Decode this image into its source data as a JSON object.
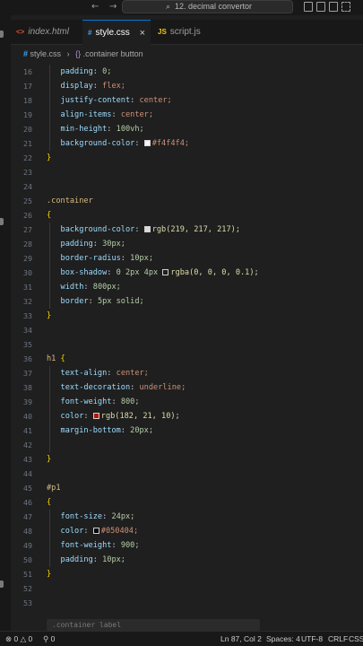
{
  "titlebar": {
    "back_icon": "arrow-left-icon",
    "forward_icon": "arrow-right-icon",
    "search_text": "12. decimal convertor"
  },
  "tabs": [
    {
      "label": "index.html",
      "icon": "html-icon",
      "icon_glyph": "<>",
      "color": "#e44d26",
      "active": false
    },
    {
      "label": "style.css",
      "icon": "css-icon",
      "icon_glyph": "#",
      "color": "#42a5f5",
      "active": true,
      "close": "×"
    },
    {
      "label": "script.js",
      "icon": "js-icon",
      "icon_glyph": "JS",
      "color": "#f1c40f",
      "active": false
    }
  ],
  "breadcrumb": {
    "file": "style.css",
    "selector": ".container button",
    "separator": "›"
  },
  "editor": {
    "colors": {
      "line_number": "#6e7681",
      "selector": "#d7ba7d",
      "property": "#9cdcfe",
      "value": "#ce9178",
      "number": "#b5cea8",
      "brace": "#ffd700",
      "function": "#dcdcaa",
      "plain": "#cccccc"
    },
    "lines": [
      {
        "n": "16",
        "indent": 1,
        "prop": "padding",
        "val": "0;"
      },
      {
        "n": "17",
        "indent": 1,
        "prop": "display",
        "val": "flex;"
      },
      {
        "n": "18",
        "indent": 1,
        "prop": "justify-content",
        "val": "center;"
      },
      {
        "n": "19",
        "indent": 1,
        "prop": "align-items",
        "val": "center;"
      },
      {
        "n": "20",
        "indent": 1,
        "prop": "min-height",
        "val": "100vh;"
      },
      {
        "n": "21",
        "indent": 1,
        "prop": "background-color",
        "val": "#f4f4f4;",
        "swatch": "#f4f4f4"
      },
      {
        "n": "22",
        "brace": "}"
      },
      {
        "n": "23"
      },
      {
        "n": "24"
      },
      {
        "n": "25",
        "selector": ".container"
      },
      {
        "n": "26",
        "brace": "{"
      },
      {
        "n": "27",
        "indent": 1,
        "prop": "background-color",
        "val": "rgb(219, 217, 217);",
        "swatch": "#dbd9d9"
      },
      {
        "n": "28",
        "indent": 1,
        "prop": "padding",
        "val": "30px;"
      },
      {
        "n": "29",
        "indent": 1,
        "prop": "border-radius",
        "val": "10px;"
      },
      {
        "n": "30",
        "indent": 1,
        "prop": "box-shadow",
        "pre": "0 2px 4px ",
        "val": "rgba(0, 0, 0, 0.1);",
        "swatch": "#1f1f1f"
      },
      {
        "n": "31",
        "indent": 1,
        "prop": "width",
        "val": "800px;"
      },
      {
        "n": "32",
        "indent": 1,
        "prop": "border",
        "val": "5px solid;"
      },
      {
        "n": "33",
        "brace": "}"
      },
      {
        "n": "34"
      },
      {
        "n": "35"
      },
      {
        "n": "36",
        "selector": "h1 ",
        "brace_inline": "{"
      },
      {
        "n": "37",
        "indent": 1,
        "prop": "text-align",
        "val": "center;"
      },
      {
        "n": "38",
        "indent": 1,
        "prop": "text-decoration",
        "val": "underline;"
      },
      {
        "n": "39",
        "indent": 1,
        "prop": "font-weight",
        "val": "800;"
      },
      {
        "n": "40",
        "indent": 1,
        "prop": "color",
        "val": "rgb(182, 21, 10);",
        "swatch": "#b6150a"
      },
      {
        "n": "41",
        "indent": 1,
        "prop": "margin-bottom",
        "val": "20px;"
      },
      {
        "n": "42"
      },
      {
        "n": "43",
        "brace": "}"
      },
      {
        "n": "44"
      },
      {
        "n": "45",
        "selector": "#p1"
      },
      {
        "n": "46",
        "brace": "{"
      },
      {
        "n": "47",
        "indent": 1,
        "prop": "font-size",
        "val": "24px;"
      },
      {
        "n": "48",
        "indent": 1,
        "prop": "color",
        "val": "#050404;",
        "swatch": "#050404"
      },
      {
        "n": "49",
        "indent": 1,
        "prop": "font-weight",
        "val": "900;"
      },
      {
        "n": "50",
        "indent": 1,
        "prop": "padding",
        "val": "10px;"
      },
      {
        "n": "51",
        "brace": "}"
      },
      {
        "n": "52"
      },
      {
        "n": "53"
      }
    ],
    "peek_hint": ".container label"
  },
  "statusbar": {
    "errors": "0",
    "warnings": "0",
    "ports": "0",
    "position": "Ln 87, Col 2",
    "spaces": "Spaces: 4",
    "encoding": "UTF-8",
    "eol": "CRLF",
    "language": "CSS"
  }
}
